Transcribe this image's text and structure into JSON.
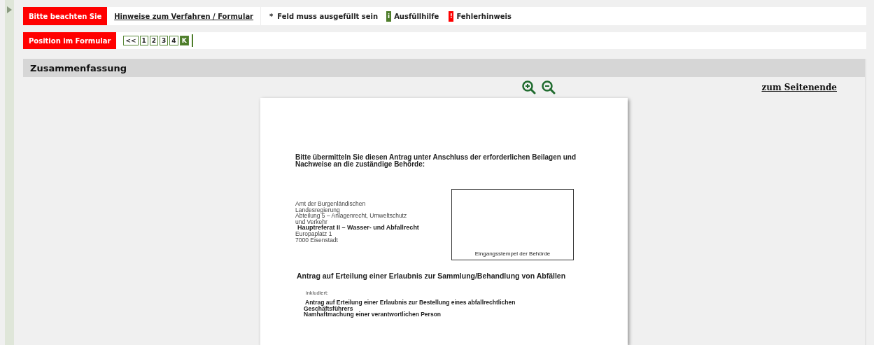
{
  "notice_bar": {
    "label": "Bitte beachten Sie",
    "link": "Hinweise zum Verfahren / Formular",
    "legend": [
      {
        "kind": "required",
        "symbol": "*",
        "text": "Feld muss ausgefüllt sein"
      },
      {
        "kind": "info",
        "symbol": "i",
        "text": "Ausfüllhilfe"
      },
      {
        "kind": "error",
        "symbol": "!",
        "text": "Fehlerhinweis"
      }
    ]
  },
  "position_bar": {
    "label": "Position im Formular",
    "pages": [
      {
        "label": "<<",
        "selected": false
      },
      {
        "label": "1",
        "selected": false
      },
      {
        "label": "2",
        "selected": false
      },
      {
        "label": "3",
        "selected": false
      },
      {
        "label": "4",
        "selected": false
      },
      {
        "label": "K",
        "selected": true
      }
    ]
  },
  "panel": {
    "title": "Zusammenfassung",
    "bottom_link": "zum Seitenende",
    "document": {
      "intro": "Bitte übermitteln Sie diesen Antrag unter Anschluss der erforderlichen Beilagen und Nachweise an die zuständige Behörde:",
      "address": [
        {
          "text": "Amt der Burgenländischen",
          "bold": false
        },
        {
          "text": "Landesregierung",
          "bold": false
        },
        {
          "text": "Abteilung 5 – Anlagenrecht, Umweltschutz",
          "bold": false
        },
        {
          "text": "und Verkehr",
          "bold": false
        },
        {
          "text": "Hauptreferat II – Wasser- und Abfallrecht",
          "bold": true
        },
        {
          "text": "Europaplatz 1",
          "bold": false
        },
        {
          "text": "7000 Eisenstadt",
          "bold": false
        }
      ],
      "stamp_label": "Eingangsstempel der Behörde",
      "heading": "Antrag auf Erteilung einer Erlaubnis zur Sammlung/Behandlung von Abfällen",
      "included_label": "inkludiert:",
      "included": [
        "Antrag auf Erteilung einer Erlaubnis zur Bestellung eines abfallrechtlichen Geschäftsführers",
        "Namhaftmachung einer verantwortlichen Person"
      ]
    }
  }
}
